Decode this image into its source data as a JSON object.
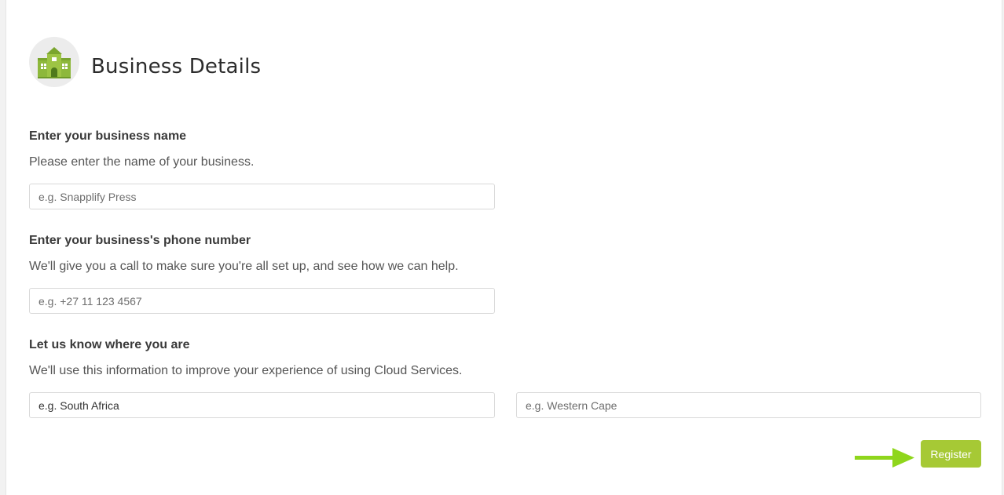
{
  "header": {
    "title": "Business Details",
    "icon": "building-icon"
  },
  "business_name": {
    "heading": "Enter your business name",
    "description": "Please enter the name of your business.",
    "placeholder": "e.g. Snapplify Press",
    "value": ""
  },
  "phone": {
    "heading": "Enter your business's phone number",
    "description": "We'll give you a call to make sure you're all set up, and see how we can help.",
    "placeholder": "e.g. +27 11 123 4567",
    "value": ""
  },
  "location": {
    "heading": "Let us know where you are",
    "description": "We'll use this information to improve your experience of using Cloud Services.",
    "country": {
      "placeholder": "e.g. South Africa",
      "value": "e.g. South Africa"
    },
    "region": {
      "placeholder": "e.g. Western Cape",
      "value": ""
    }
  },
  "actions": {
    "register_label": "Register"
  },
  "colors": {
    "accent": "#a6c935",
    "arrow": "#8fd61c",
    "icon_green": "#8db83b"
  }
}
